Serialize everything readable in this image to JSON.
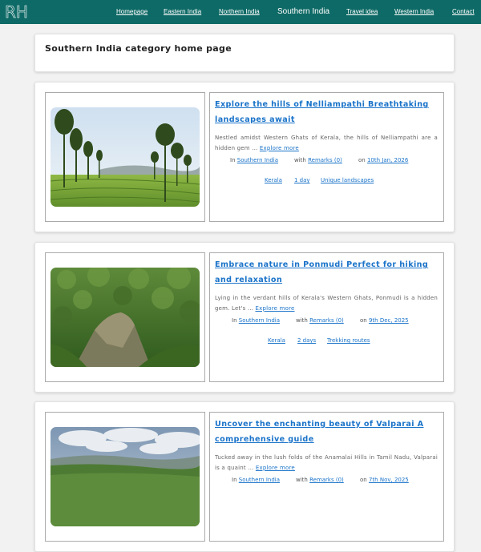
{
  "header": {
    "logo": "RH",
    "nav": [
      "Homepage",
      "Eastern India",
      "Northern India",
      "Southern India",
      "Travel idea",
      "Western India",
      "Contact"
    ],
    "active": "Southern India",
    "background": "#0e6a66"
  },
  "page_title": "Southern India category home page",
  "posts": [
    {
      "title": "Explore the hills of Nelliampathi Breathtaking landscapes await",
      "excerpt": "Nestled amidst Western Ghats of Kerala, the hills of Nelliampathi are a hidden gem …",
      "more": "Explore more",
      "in_label": "In",
      "category": "Southern India",
      "with_label": "with",
      "remarks": "Remarks (0)",
      "on_label": "on",
      "date": "10th Jan, 2026",
      "tags": [
        "Kerala",
        "1 day",
        "Unique landscapes"
      ],
      "image": "tea-plantation-trees"
    },
    {
      "title": "Embrace nature in Ponmudi Perfect for hiking and relaxation",
      "excerpt": "Lying in the verdant hills of Kerala's Western Ghats, Ponmudi is a hidden gem. Let's …",
      "more": "Explore more",
      "in_label": "In",
      "category": "Southern India",
      "with_label": "with",
      "remarks": "Remarks (0)",
      "on_label": "on",
      "date": "9th Dec, 2025",
      "tags": [
        "Kerala",
        "2 days",
        "Trekking routes"
      ],
      "image": "green-forested-cliff"
    },
    {
      "title": "Uncover the enchanting beauty of Valparai A comprehensive guide",
      "excerpt": "Tucked away in the lush folds of the Anamalai Hills in Tamil Nadu, Valparai is a quaint …",
      "more": "Explore more",
      "in_label": "In",
      "category": "Southern India",
      "with_label": "with",
      "remarks": "Remarks (0)",
      "on_label": "on",
      "date": "7th Nov, 2025",
      "tags": [],
      "image": "cloudy-valley-view"
    }
  ]
}
